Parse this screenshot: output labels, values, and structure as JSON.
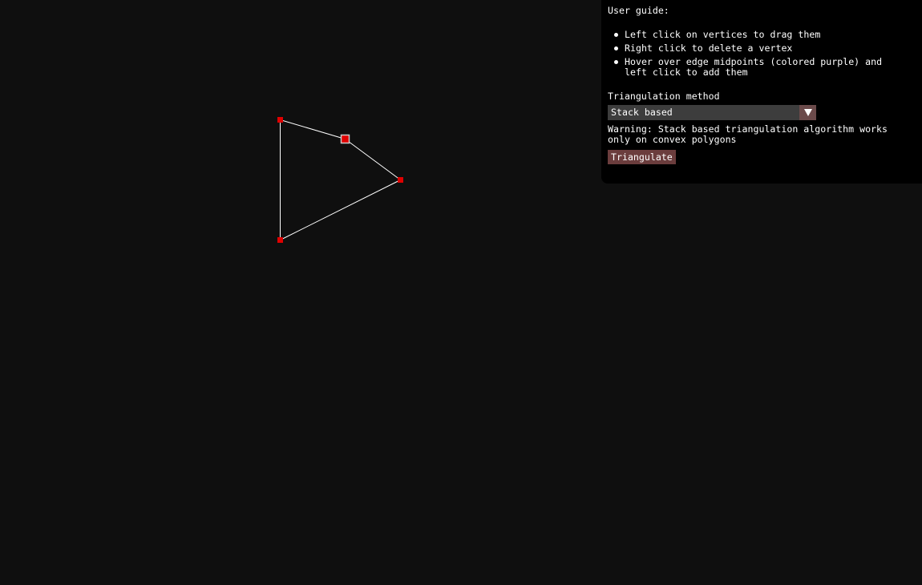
{
  "canvas": {
    "background": "#0f0f0f",
    "edge_color": "#ffffff",
    "vertex_color": "#e00000",
    "midpoint_border_color": "#c8c8c8"
  },
  "panel": {
    "guide_title": "User guide:",
    "guide_items": [
      "Left click on vertices to drag them",
      "Right click to delete a vertex",
      "Hover over edge midpoints (colored purple) and left click to add them"
    ],
    "method_label": "Triangulation method",
    "method_selected": "Stack based",
    "warning": "Warning: Stack based triangulation algorithm works only on convex polygons",
    "triangulate_label": "Triangulate"
  }
}
